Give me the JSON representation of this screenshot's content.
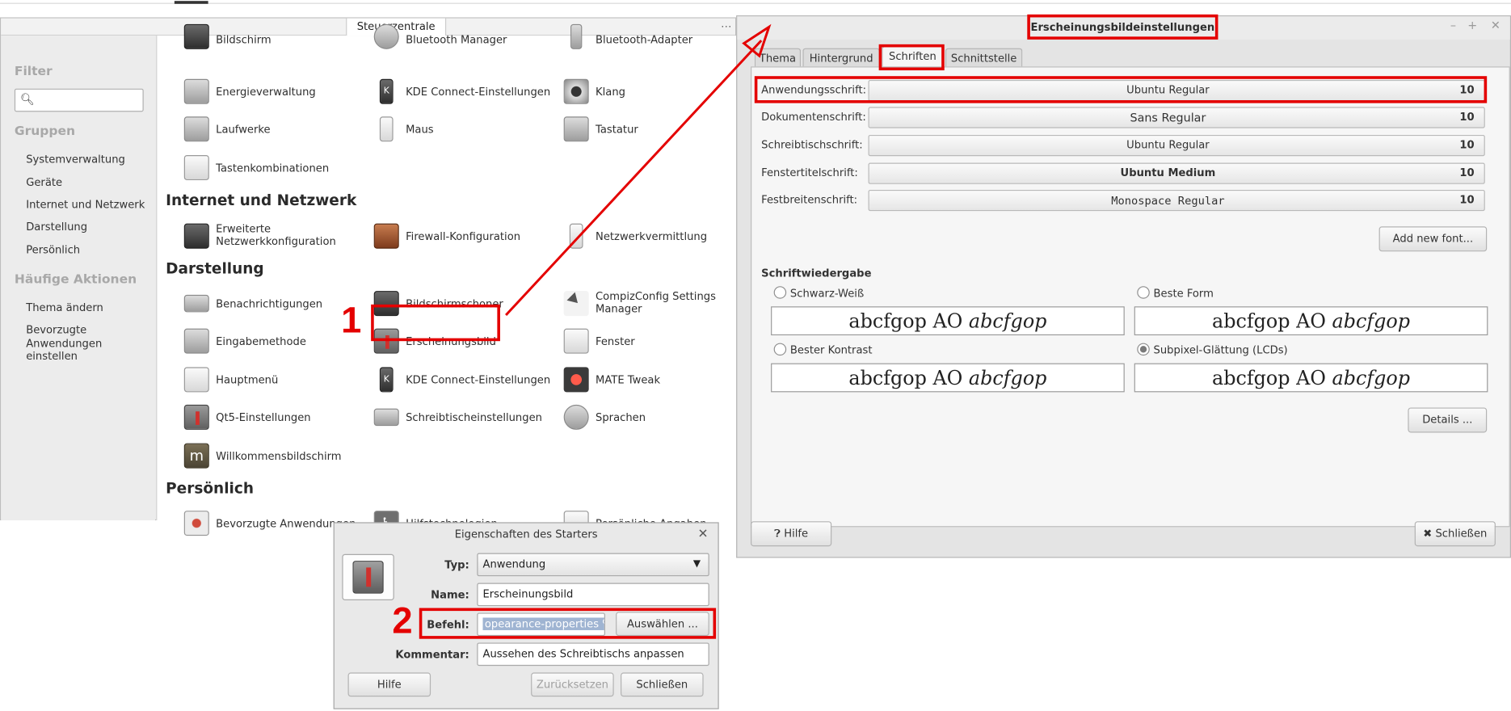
{
  "control_center": {
    "title": "Steuerzentrale",
    "filter_heading": "Filter",
    "search_placeholder": "",
    "groups_heading": "Gruppen",
    "groups": [
      "Systemverwaltung",
      "Geräte",
      "Internet und Netzwerk",
      "Darstellung",
      "Persönlich"
    ],
    "actions_heading": "Häufige Aktionen",
    "actions": [
      "Thema ändern",
      "Bevorzugte Anwendungen einstellen"
    ],
    "sections": [
      "Internet und Netzwerk",
      "Darstellung",
      "Persönlich"
    ],
    "items": {
      "bildschirm": "Bildschirm",
      "bluetooth_manager": "Bluetooth Manager",
      "bluetooth_adapter": "Bluetooth-Adapter",
      "energie": "Energieverwaltung",
      "kde_connect_1": "KDE Connect-Einstellungen",
      "klang": "Klang",
      "laufwerke": "Laufwerke",
      "maus": "Maus",
      "tastatur": "Tastatur",
      "tastenkombinationen": "Tastenkombinationen",
      "netzwerkkonfig": "Erweiterte Netzwerkkonfiguration",
      "firewall": "Firewall-Konfiguration",
      "netzwerkvermittlung": "Netzwerkvermittlung",
      "benachrichtigungen": "Benachrichtigungen",
      "bildschirmschoner": "Bildschirmschoner",
      "compiz": "CompizConfig Settings Manager",
      "eingabemethode": "Eingabemethode",
      "erscheinungsbild": "Erscheinungsbild",
      "fenster": "Fenster",
      "hauptmenue": "Hauptmenü",
      "kde_connect_2": "KDE Connect-Einstellungen",
      "mate_tweak": "MATE Tweak",
      "qt5": "Qt5-Einstellungen",
      "schreibtisch": "Schreibtischeinstellungen",
      "sprachen": "Sprachen",
      "willkommen": "Willkommensbildschirm",
      "bevorzugte": "Bevorzugte Anwendungen",
      "hilfstechnologien": "Hilfstechnologien",
      "persoenlich": "Persönliche Angaben"
    }
  },
  "appearance": {
    "title": "Erscheinungsbildeinstellungen",
    "tabs": [
      "Thema",
      "Hintergrund",
      "Schriften",
      "Schnittstelle"
    ],
    "active_tab": "Schriften",
    "fonts": [
      {
        "label": "Anwendungsschrift:",
        "font": "Ubuntu Regular",
        "size": "10"
      },
      {
        "label": "Dokumentenschrift:",
        "font": "Sans Regular",
        "size": "10"
      },
      {
        "label": "Schreibtischschrift:",
        "font": "Ubuntu Regular",
        "size": "10"
      },
      {
        "label": "Fenstertitelschrift:",
        "font": "Ubuntu Medium",
        "size": "10"
      },
      {
        "label": "Festbreitenschrift:",
        "font": "Monospace Regular",
        "size": "10"
      }
    ],
    "add_font_label": "Add new font...",
    "rendering_heading": "Schriftwiedergabe",
    "rendering_options": [
      {
        "label": "Schwarz-Weiß",
        "selected": false
      },
      {
        "label": "Beste Form",
        "selected": false
      },
      {
        "label": "Bester Kontrast",
        "selected": false
      },
      {
        "label": "Subpixel-Glättung (LCDs)",
        "selected": true
      }
    ],
    "preview_text": "abcfgop AO ",
    "preview_italic": "abcfgop",
    "details_label": "Details ...",
    "help_label": "Hilfe",
    "close_label": "Schließen"
  },
  "starter": {
    "title": "Eigenschaften des Starters",
    "type_label": "Typ:",
    "type_value": "Anwendung",
    "name_label": "Name:",
    "name_value": "Erscheinungsbild",
    "command_label": "Befehl:",
    "command_value": "opearance-properties %F",
    "browse_label": "Auswählen ...",
    "comment_label": "Kommentar:",
    "comment_value": "Aussehen des Schreibtischs anpassen",
    "help_label": "Hilfe",
    "reset_label": "Zurücksetzen",
    "close_label": "Schließen"
  },
  "annotations": {
    "step1": "1",
    "step2": "2",
    "accent_color": "#e40000"
  }
}
